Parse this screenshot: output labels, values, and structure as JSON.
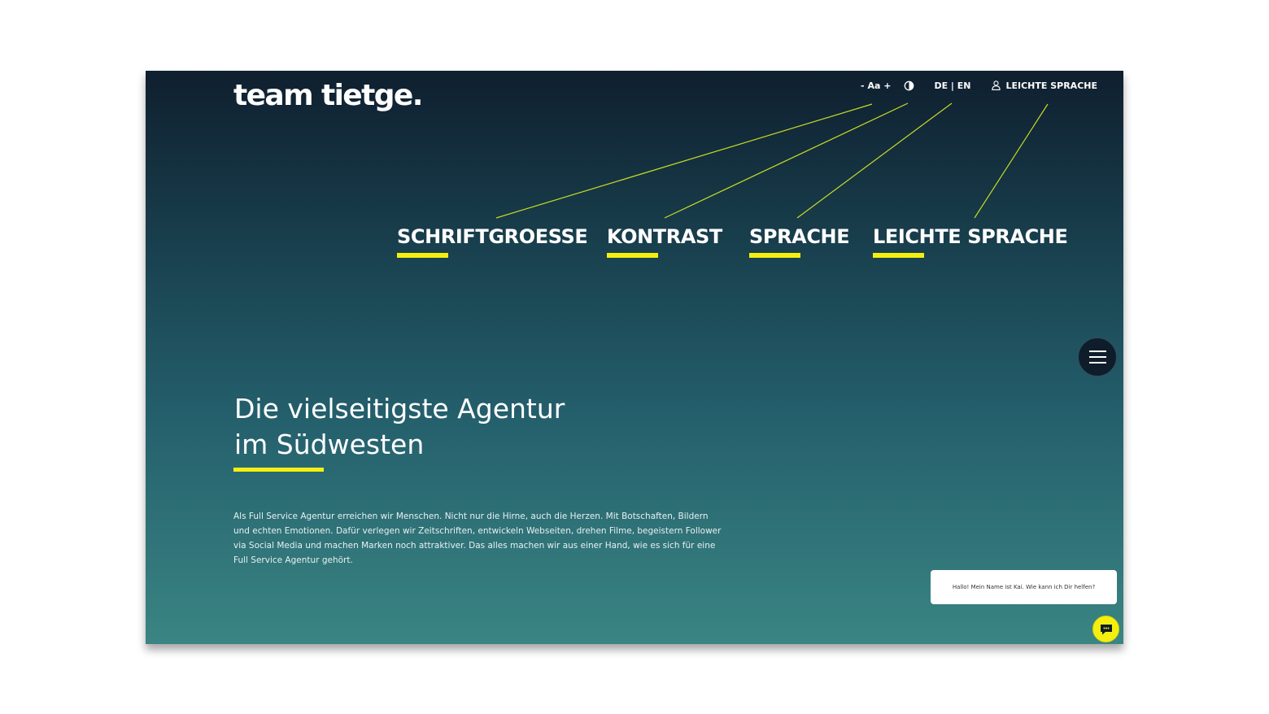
{
  "brand": {
    "logo_text": "team tietge."
  },
  "topbar": {
    "font_size": "- Aa +",
    "contrast_icon": "contrast-icon",
    "language": "DE | EN",
    "easy_language_icon": "user-icon",
    "easy_language": "LEICHTE SPRACHE"
  },
  "callouts": [
    {
      "label": "SCHRIFTGROESSE"
    },
    {
      "label": "KONTRAST"
    },
    {
      "label": "SPRACHE"
    },
    {
      "label": "LEICHTE SPRACHE"
    }
  ],
  "hero": {
    "headline_line1": "Die vielseitigste Agentur",
    "headline_line2": "im Südwesten",
    "intro": "Als Full Service Agentur erreichen wir Menschen. Nicht nur die Hirne, auch die Herzen. Mit Botschaften, Bildern und echten Emotionen. Dafür verlegen wir Zeitschriften, entwickeln Webseiten, drehen Filme, begeistern Follower via Social Media und machen Marken noch attraktiver. Das alles machen wir aus einer Hand, wie es sich für eine Full Service Agentur gehört."
  },
  "menu": {
    "icon": "hamburger-menu-icon"
  },
  "chat": {
    "greeting": "Hallo! Mein Name ist Kai. Wie kann ich Dir helfen?",
    "icon": "chat-icon"
  },
  "colors": {
    "accent": "#f5ef10",
    "bg_top": "#0f1f2f",
    "bg_bottom": "#3a8583",
    "leader_line": "#c8dc24"
  }
}
